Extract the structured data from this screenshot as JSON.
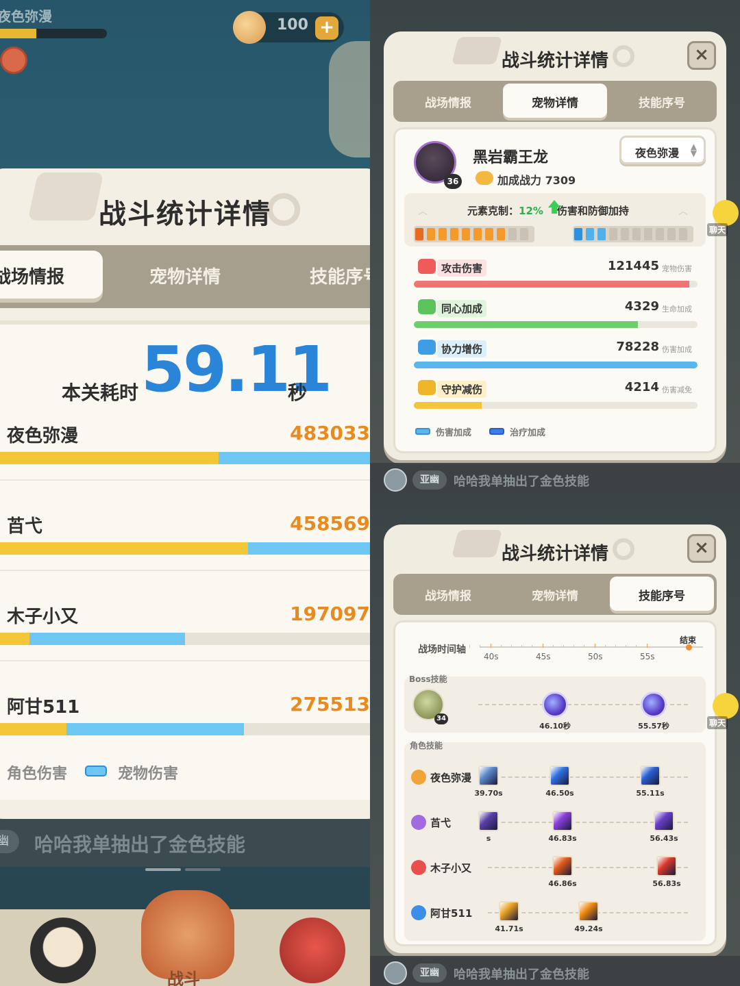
{
  "left": {
    "hud": {
      "player_name": "夜色弥漫",
      "coins": "100",
      "plus": "+"
    },
    "panel": {
      "title": "战斗统计详情",
      "tabs": [
        {
          "label": "战场情报"
        },
        {
          "label": "宠物详情"
        },
        {
          "label": "技能序号"
        }
      ],
      "time_label": "本关耗时",
      "time_value": "59.11",
      "time_unit": "秒",
      "players": [
        {
          "name": "夜色弥漫",
          "value": "483033",
          "role_fraction": 0.59,
          "pet_fraction": 0.41
        },
        {
          "name": "苩弋",
          "value": "458569",
          "role_fraction": 0.67,
          "pet_fraction": 0.33
        },
        {
          "name": "木子小又",
          "value": "197097",
          "role_fraction": 0.08,
          "pet_fraction": 0.42
        },
        {
          "name": "阿甘511",
          "value": "275513",
          "role_fraction": 0.18,
          "pet_fraction": 0.48
        }
      ],
      "legend": {
        "role": "角色伤害",
        "pet": "宠物伤害"
      }
    },
    "chat": {
      "tag": "幽",
      "text": "哈哈我单抽出了金色技能"
    },
    "bottom": {
      "battle_label": "战斗"
    }
  },
  "pet": {
    "title": "战斗统计详情",
    "close": "×",
    "tabs": [
      {
        "label": "战场情报"
      },
      {
        "label": "宠物详情"
      },
      {
        "label": "技能序号"
      }
    ],
    "pet_name": "黑岩霸王龙",
    "level": "36",
    "power_label": "加成战力 7309",
    "owner": "夜色弥漫",
    "element": {
      "prefix": "元素克制：",
      "percent": "12%",
      "suffix": "伤害和防御加持",
      "fire_level": 8,
      "ice_level": 2,
      "segments": 10
    },
    "stats": [
      {
        "label": "攻击伤害",
        "value": "121445",
        "unit": "宠物伤害",
        "fraction": 0.97,
        "color": "#f07474",
        "label_bg": "#fde0e0",
        "icon_color": "#ef5a5a"
      },
      {
        "label": "同心加成",
        "value": "4329",
        "unit": "生命加成",
        "fraction": 0.79,
        "color": "#6ccf6c",
        "label_bg": "#dff4db",
        "icon_color": "#5cc45c"
      },
      {
        "label": "协力增伤",
        "value": "78228",
        "unit": "伤害加成",
        "fraction": 1.0,
        "color": "#5bb6ee",
        "label_bg": "#dbeefb",
        "icon_color": "#3d9ee6"
      },
      {
        "label": "守护减伤",
        "value": "4214",
        "unit": "伤害减免",
        "fraction": 0.24,
        "color": "#f3c53a",
        "label_bg": "#fdf0c9",
        "icon_color": "#f0b62a"
      }
    ],
    "legend": {
      "damage": "伤害加成",
      "heal": "治疗加成"
    },
    "chat": {
      "tag": "亚幽",
      "text": "哈哈我单抽出了金色技能",
      "bubble": "聊天"
    }
  },
  "skills": {
    "title": "战斗统计详情",
    "close": "×",
    "tabs": [
      {
        "label": "战场情报"
      },
      {
        "label": "宠物详情"
      },
      {
        "label": "技能序号"
      }
    ],
    "timeline_label": "战场时间轴",
    "timeline_end": "结束",
    "ticks": [
      "40s",
      "45s",
      "50s",
      "55s"
    ],
    "boss_label": "Boss技能",
    "boss_level": "34",
    "boss_skills": [
      "46.10秒",
      "55.57秒"
    ],
    "role_label": "角色技能",
    "roles": [
      {
        "name": "夜色弥漫",
        "icon_color": "#f2a43a",
        "skills": [
          {
            "time": "39.70s",
            "color": "#5b86c8"
          },
          {
            "time": "46.50s",
            "color": "#2f6fe0"
          },
          {
            "time": "55.11s",
            "color": "#2a5fd0"
          }
        ]
      },
      {
        "name": "苩弋",
        "icon_color": "#a36be0",
        "skills": [
          {
            "time": "s",
            "color": "#5a3fa8"
          },
          {
            "time": "46.83s",
            "color": "#8a3fd8"
          },
          {
            "time": "56.43s",
            "color": "#6a3fc8"
          }
        ]
      },
      {
        "name": "木子小又",
        "icon_color": "#e85050",
        "skills": [
          {
            "time": "46.86s",
            "color": "#e05a1a"
          },
          {
            "time": "56.83s",
            "color": "#d8392a"
          }
        ]
      },
      {
        "name": "阿甘511",
        "icon_color": "#3d8ee6",
        "skills": [
          {
            "time": "41.71s",
            "color": "#e8a020"
          },
          {
            "time": "49.24s",
            "color": "#f08a10"
          }
        ]
      }
    ],
    "chat": {
      "tag": "亚幽",
      "text": "哈哈我单抽出了金色技能",
      "bubble": "聊天"
    }
  }
}
